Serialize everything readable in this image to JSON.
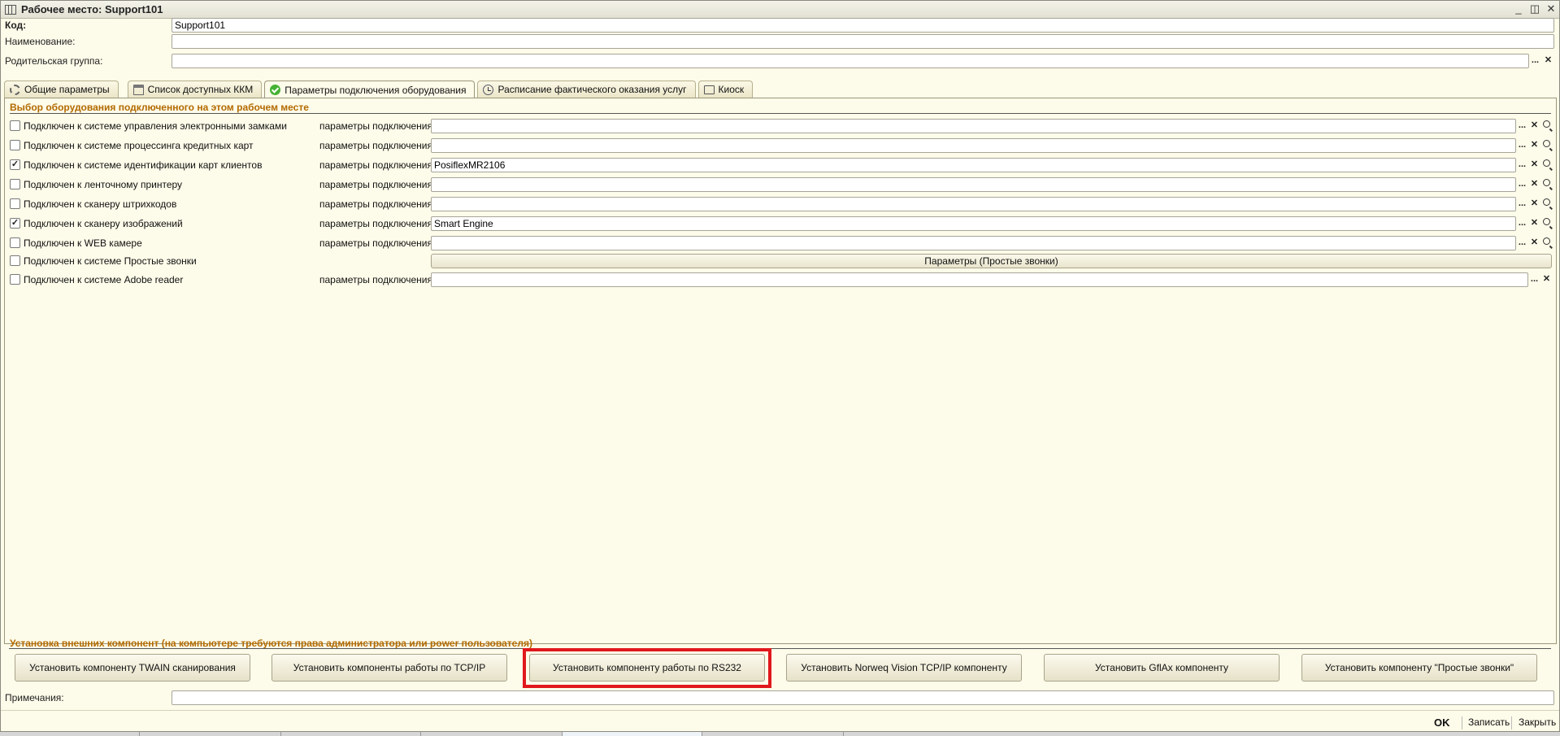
{
  "window": {
    "title": "Рабочее место: Support101",
    "minimize": "_",
    "restore": "◫",
    "close": "✕"
  },
  "fields": {
    "code_label": "Код:",
    "code_value": "Support101",
    "name_label": "Наименование:",
    "name_value": "",
    "parent_label": "Родительская группа:",
    "parent_value": ""
  },
  "tabs": [
    {
      "label": "Общие параметры",
      "icon": "gear-icon"
    },
    {
      "label": "Список доступных ККМ",
      "icon": "register-icon"
    },
    {
      "label": "Параметры подключения оборудования",
      "icon": "check-icon",
      "active": true
    },
    {
      "label": "Расписание фактического оказания услуг",
      "icon": "clock-icon"
    },
    {
      "label": "Киоск",
      "icon": "monitor-icon"
    }
  ],
  "section_equipment": "Выбор оборудования подключенного на этом рабочем месте",
  "param_label": "параметры подключения:",
  "equipment": [
    {
      "label": "Подключен к системе управления электронными замками",
      "checked": false,
      "value": ""
    },
    {
      "label": "Подключен к системе процессинга кредитных карт",
      "checked": false,
      "value": ""
    },
    {
      "label": "Подключен к системе идентификации карт клиентов",
      "checked": true,
      "value": "PosiflexMR2106"
    },
    {
      "label": "Подключен к ленточному принтеру",
      "checked": false,
      "value": ""
    },
    {
      "label": "Подключен к сканеру штрихкодов",
      "checked": false,
      "value": ""
    },
    {
      "label": "Подключен к сканеру изображений",
      "checked": true,
      "value": "Smart Engine"
    },
    {
      "label": "Подключен к WEB камере",
      "checked": false,
      "value": ""
    },
    {
      "label": "Подключен к системе Простые звонки",
      "checked": false,
      "button": "Параметры (Простые звонки)"
    },
    {
      "label": "Подключен к системе Adobe reader",
      "checked": false,
      "value": ""
    }
  ],
  "section_components": "Установка внешних компонент (на компьютере требуются права администратора или power пользователя)",
  "install_buttons": [
    "Установить компоненту TWAIN сканирования",
    "Установить компоненты работы по TCP/IP",
    "Установить компоненту работы по RS232",
    "Установить Norweq Vision TCP/IP компоненту",
    "Установить GflAx компоненту",
    "Установить компоненту \"Простые звонки\""
  ],
  "notes_label": "Примечания:",
  "notes_value": "",
  "footer": {
    "ok": "OK",
    "save": "Записать",
    "close": "Закрыть"
  },
  "glyphs": {
    "dots": "...",
    "clear": "✕",
    "check": "✓"
  },
  "colors": {
    "window_bg": "#fdfbe9",
    "section_title": "#b36a00",
    "highlight": "#e0181c"
  }
}
